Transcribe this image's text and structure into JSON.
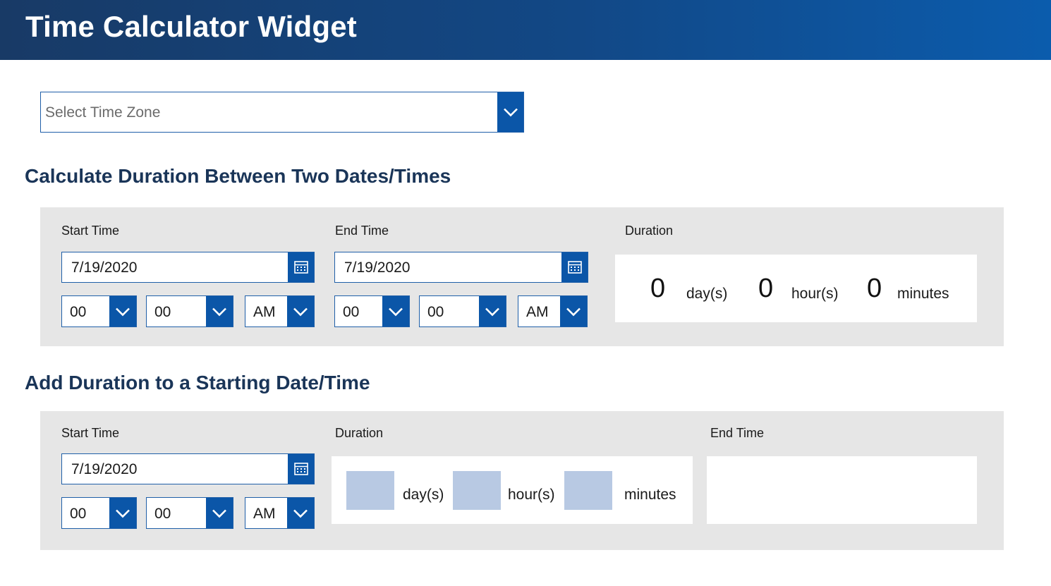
{
  "header": {
    "title": "Time Calculator Widget"
  },
  "timezone": {
    "placeholder": "Select Time Zone"
  },
  "section1": {
    "title": "Calculate Duration Between Two Dates/Times",
    "start": {
      "label": "Start Time",
      "date": "7/19/2020",
      "hour": "00",
      "minute": "00",
      "ampm": "AM"
    },
    "end": {
      "label": "End Time",
      "date": "7/19/2020",
      "hour": "00",
      "minute": "00",
      "ampm": "AM"
    },
    "duration": {
      "label": "Duration",
      "days": "0",
      "days_unit": "day(s)",
      "hours": "0",
      "hours_unit": "hour(s)",
      "minutes": "0",
      "minutes_unit": "minutes"
    }
  },
  "section2": {
    "title": "Add Duration to a Starting Date/Time",
    "start": {
      "label": "Start Time",
      "date": "7/19/2020",
      "hour": "00",
      "minute": "00",
      "ampm": "AM"
    },
    "duration": {
      "label": "Duration",
      "days_unit": "day(s)",
      "hours_unit": "hour(s)",
      "minutes_unit": "minutes"
    },
    "end": {
      "label": "End Time"
    }
  },
  "colors": {
    "accent": "#0b56a8",
    "header_start": "#183a66",
    "header_end": "#0b5cad",
    "panel_bg": "#e6e6e6",
    "input_fill": "#b8c9e3"
  },
  "icons": {
    "dropdown": "chevron-down-icon",
    "date_picker": "calendar-icon"
  }
}
